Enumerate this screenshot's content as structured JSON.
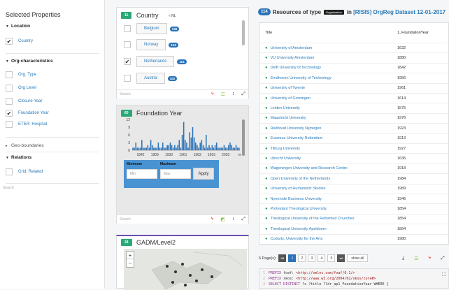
{
  "left_panel": {
    "title": "Selected Properties",
    "location": {
      "label": "Location",
      "items": [
        {
          "label": "Country",
          "checked": true
        }
      ]
    },
    "org": {
      "label": "Org-characteristics",
      "items": [
        {
          "label": "Org. Type",
          "checked": false
        },
        {
          "label": "Org Level",
          "checked": false
        },
        {
          "label": "Closure Year",
          "checked": false
        },
        {
          "label": "Foundation Year",
          "checked": true
        },
        {
          "label": "ETER: Hospital",
          "checked": false
        }
      ]
    },
    "geo": {
      "label": "Geo-boundaries"
    },
    "relations": {
      "label": "Relations",
      "items": [
        {
          "label": "Grid: Related",
          "checked": false
        }
      ]
    },
    "search_placeholder": "Search"
  },
  "country_card": {
    "count": "11",
    "title": "Country",
    "sort_label": "≈ NL",
    "items": [
      {
        "name": "Belgium",
        "count": "136",
        "checked": false
      },
      {
        "name": "Norway",
        "count": "123",
        "checked": false
      },
      {
        "name": "Netherlands",
        "count": "114",
        "checked": true
      },
      {
        "name": "Austria",
        "count": "102",
        "checked": false
      }
    ],
    "search_placeholder": "Search"
  },
  "foundation_card": {
    "count": "60",
    "title": "Foundation Year",
    "min_label": "Minimum",
    "max_label": "Maximum",
    "min_placeholder": "Min",
    "max_placeholder": "Max",
    "apply_label": "Apply",
    "search_placeholder": "Search"
  },
  "chart_data": {
    "type": "bar",
    "y_ticks": [
      "12",
      "9",
      "6",
      "3",
      "0"
    ],
    "x_ticks": [
      "1842",
      "1909",
      "1930",
      "1961",
      "1983",
      "1993",
      "2003",
      "m"
    ],
    "ylim": [
      0,
      12
    ],
    "values": [
      1,
      1,
      3,
      1,
      1,
      1,
      4,
      1,
      1,
      1,
      2,
      1,
      4,
      2,
      1,
      1,
      1,
      3,
      1,
      1,
      3,
      1,
      1,
      2,
      2,
      3,
      2,
      1,
      2,
      1,
      2,
      4,
      1,
      6,
      11,
      4,
      3,
      1,
      7,
      5,
      9,
      5,
      3,
      2,
      1,
      3,
      4,
      2,
      1,
      6,
      1,
      2,
      1,
      2,
      1,
      2,
      3,
      1,
      1,
      1,
      1,
      2,
      1,
      1,
      2,
      3,
      2,
      1,
      1,
      2,
      1,
      1
    ],
    "bar_color": "#2a73b8"
  },
  "gadm_card": {
    "count": "34",
    "title": "GADM/Level2",
    "zoom_in": "+",
    "zoom_out": "−"
  },
  "resources": {
    "count": "114",
    "pre": "Resources of type",
    "type_tag": "Organisation",
    "mid": "in",
    "dataset": "[RISIS] OrgReg Dataset 12-01-2017",
    "col_title": "Title",
    "col_year": "1_FoundationYear",
    "rows": [
      {
        "t": "University of Amsterdam",
        "y": "1632"
      },
      {
        "t": "VU University Amsterdam",
        "y": "1880"
      },
      {
        "t": "Delft University of Technology",
        "y": "1842"
      },
      {
        "t": "Eindhoven University of Technology",
        "y": "1956"
      },
      {
        "t": "University of Twente",
        "y": "1961"
      },
      {
        "t": "University of Groningen",
        "y": "1614"
      },
      {
        "t": "Leiden University",
        "y": "1575"
      },
      {
        "t": "Maastricht University",
        "y": "1976"
      },
      {
        "t": "Radboud University Nijmegen",
        "y": "1923"
      },
      {
        "t": "Erasmus University Rotterdam",
        "y": "1913"
      },
      {
        "t": "Tilburg University",
        "y": "1927"
      },
      {
        "t": "Utrecht University",
        "y": "1636"
      },
      {
        "t": "Wageningen University and Research Centre",
        "y": "1918"
      },
      {
        "t": "Open University of the Netherlands",
        "y": "1984"
      },
      {
        "t": "University of Humanistic Studies",
        "y": "1989"
      },
      {
        "t": "Nyenrode Business University",
        "y": "1946"
      },
      {
        "t": "Protestant Theological University",
        "y": "1854"
      },
      {
        "t": "Theological University of the Reformed Churches",
        "y": "1854"
      },
      {
        "t": "Theological University Apeldoorn",
        "y": "1894"
      },
      {
        "t": "Codarts, University for the Arts",
        "y": "1980"
      }
    ],
    "pager_label": "6 Page(s):",
    "pages": [
      "1",
      "2",
      "3",
      "4",
      "5"
    ],
    "show_all": "show all"
  },
  "code": {
    "l1a": "PREFIX ",
    "l1b": "foaf: ",
    "l1c": "<http://xmlns.com/foaf/0.1/>",
    "l2a": "PREFIX ",
    "l2b": "skos: ",
    "l2c": "<http://www.w3.org/2004/02/skos/core#>",
    "l3a": "SELECT DISTINCT ",
    "l3b": "?s  ?title  ?ldr_ap1_FoundationYear WHERE {"
  }
}
